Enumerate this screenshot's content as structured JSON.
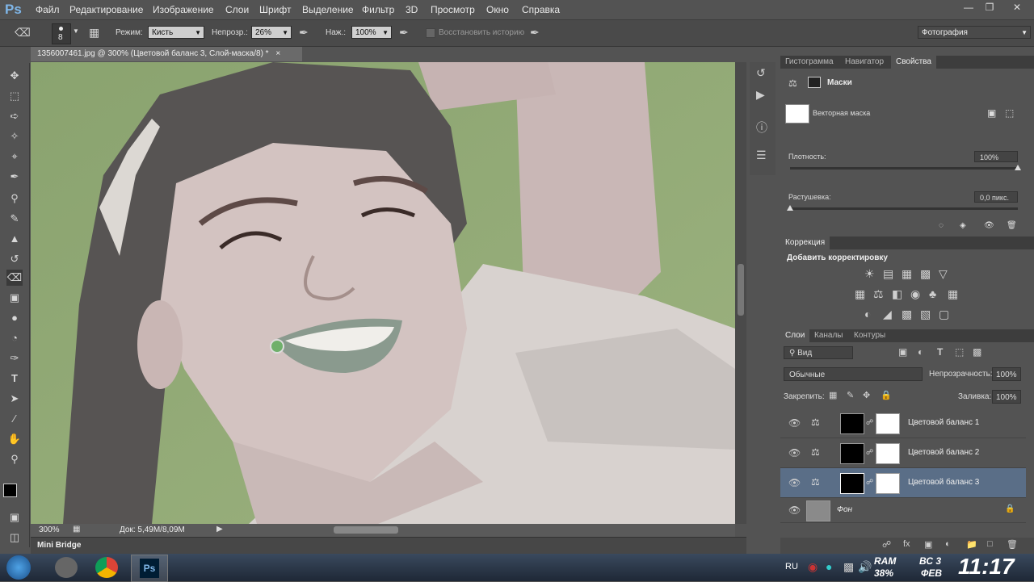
{
  "menu": {
    "logo": "Ps",
    "items": [
      "Файл",
      "Редактирование",
      "Изображение",
      "Слои",
      "Шрифт",
      "Выделение",
      "Фильтр",
      "3D",
      "Просмотр",
      "Окно",
      "Справка"
    ]
  },
  "options": {
    "brush_size": "8",
    "mode_label": "Режим:",
    "mode_value": "Кисть",
    "opacity_label": "Непрозр.:",
    "opacity_value": "26%",
    "flow_label": "Наж.:",
    "flow_value": "100%",
    "restore_history": "Восстановить историю",
    "workspace": "Фотография"
  },
  "document": {
    "tab_title": "1356007461.jpg @ 300% (Цветовой баланс 3, Слой-маска/8) *",
    "zoom": "300%",
    "doc_size": "Док: 5,49M/8,09M"
  },
  "mini_bridge": "Mini Bridge",
  "properties_panel": {
    "tabs": [
      "Гистограмма",
      "Навигатор",
      "Свойства"
    ],
    "title": "Маски",
    "vector_mask": "Векторная маска",
    "density_label": "Плотность:",
    "density_value": "100%",
    "density_level": 1.0,
    "feather_label": "Растушевка:",
    "feather_value": "0,0 пикс."
  },
  "adjustments_panel": {
    "tab": "Коррекция",
    "title": "Добавить корректировку"
  },
  "layers_panel": {
    "tabs": [
      "Слои",
      "Каналы",
      "Контуры"
    ],
    "filter_kind": "Вид",
    "blend_mode": "Обычные",
    "opacity_label": "Непрозрачность:",
    "opacity_value": "100%",
    "lock_label": "Закрепить:",
    "fill_label": "Заливка:",
    "fill_value": "100%",
    "layers": [
      {
        "name": "Цветовой баланс 1"
      },
      {
        "name": "Цветовой баланс 2"
      },
      {
        "name": "Цветовой баланс 3"
      },
      {
        "name": "Фон"
      }
    ]
  },
  "taskbar": {
    "lang": "RU",
    "ram_label": "RAM",
    "ram_value": "38%",
    "day": "ВС 3",
    "month": "ФЕВ",
    "time": "11:17"
  },
  "colors": {
    "accent": "#7fb6e8",
    "selected_layer": "#5a6e87",
    "grass": "#8fa774"
  }
}
